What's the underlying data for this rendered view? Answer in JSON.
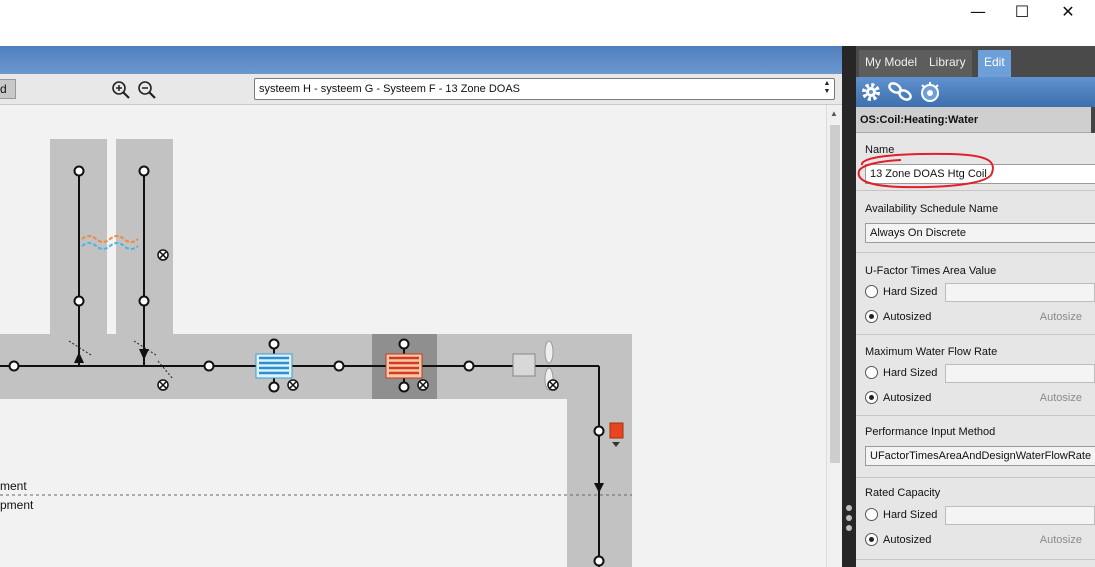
{
  "window": {
    "minimize_glyph": "—",
    "maximize_glyph": "☐",
    "close_glyph": "✕"
  },
  "toolbar": {
    "left_button_label": "d",
    "zoom_in_icon": "zoom-in-icon",
    "zoom_out_icon": "zoom-out-icon",
    "loop_selector_value": "systeem H - systeem G - Systeem F - 13 Zone DOAS"
  },
  "canvas": {
    "label_1": "ment",
    "label_2": "pment"
  },
  "right_panel": {
    "tabs": [
      {
        "label": "My Model"
      },
      {
        "label": "Library"
      },
      {
        "label": "Edit"
      }
    ],
    "active_tab": "Edit",
    "icons": [
      "gear-icon",
      "link-icon",
      "measure-icon"
    ],
    "object_type": "OS:Coil:Heating:Water",
    "fields": {
      "name": {
        "label": "Name",
        "value": "13 Zone DOAS Htg Coil"
      },
      "availability": {
        "label": "Availability Schedule Name",
        "value": "Always On Discrete"
      },
      "ufactor": {
        "label": "U-Factor Times Area Value",
        "hard_sized": "Hard Sized",
        "autosized": "Autosized",
        "autosize_btn": "Autosize",
        "selected": "Autosized"
      },
      "max_water_flow": {
        "label": "Maximum Water Flow Rate",
        "hard_sized": "Hard Sized",
        "autosized": "Autosized",
        "autosize_btn": "Autosize",
        "selected": "Autosized"
      },
      "performance_input": {
        "label": "Performance Input Method",
        "value": "UFactorTimesAreaAndDesignWaterFlowRate"
      },
      "rated_capacity": {
        "label": "Rated Capacity",
        "hard_sized": "Hard Sized",
        "autosized": "Autosized",
        "autosize_btn": "Autosize",
        "selected": "Autosized"
      }
    }
  },
  "colors": {
    "accent_blue": "#6d9fd8",
    "annotation_red": "#e0202a",
    "loop_gray": "#c2c2c2"
  }
}
